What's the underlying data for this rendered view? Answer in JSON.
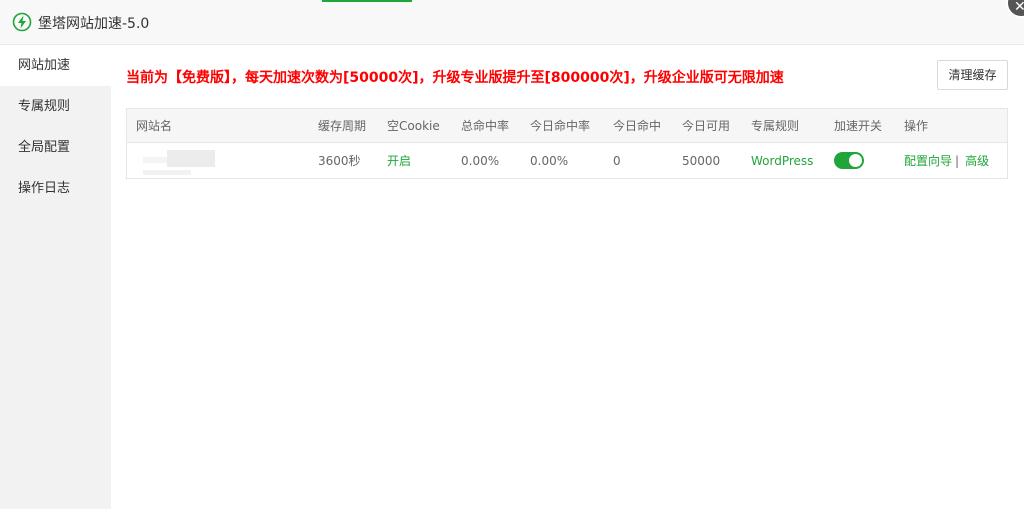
{
  "window": {
    "title": "堡塔网站加速-5.0",
    "accent_color": "#20a53a",
    "icon": "lightning-bolt-icon",
    "close_icon": "close-icon"
  },
  "sidebar": {
    "items": [
      {
        "label": "网站加速",
        "active": true
      },
      {
        "label": "专属规则",
        "active": false
      },
      {
        "label": "全局配置",
        "active": false
      },
      {
        "label": "操作日志",
        "active": false
      }
    ]
  },
  "main": {
    "notice": "当前为【免费版】，每天加速次数为[50000次]，升级专业版提升至[800000次]，升级企业版可无限加速",
    "notice_color": "#ff0000",
    "clear_cache_label": "清理缓存"
  },
  "table": {
    "headers": [
      "网站名",
      "缓存周期",
      "空Cookie",
      "总命中率",
      "今日命中率",
      "今日命中",
      "今日可用",
      "专属规则",
      "加速开关",
      "操作"
    ],
    "rows": [
      {
        "site_name": "",
        "cache_period": "3600秒",
        "empty_cookie": "开启",
        "total_hit_rate": "0.00%",
        "today_hit_rate": "0.00%",
        "today_hits": "0",
        "today_available": "50000",
        "rule": "WordPress",
        "accelerate_on": true,
        "actions": [
          "配置向导",
          "高级"
        ]
      }
    ]
  }
}
